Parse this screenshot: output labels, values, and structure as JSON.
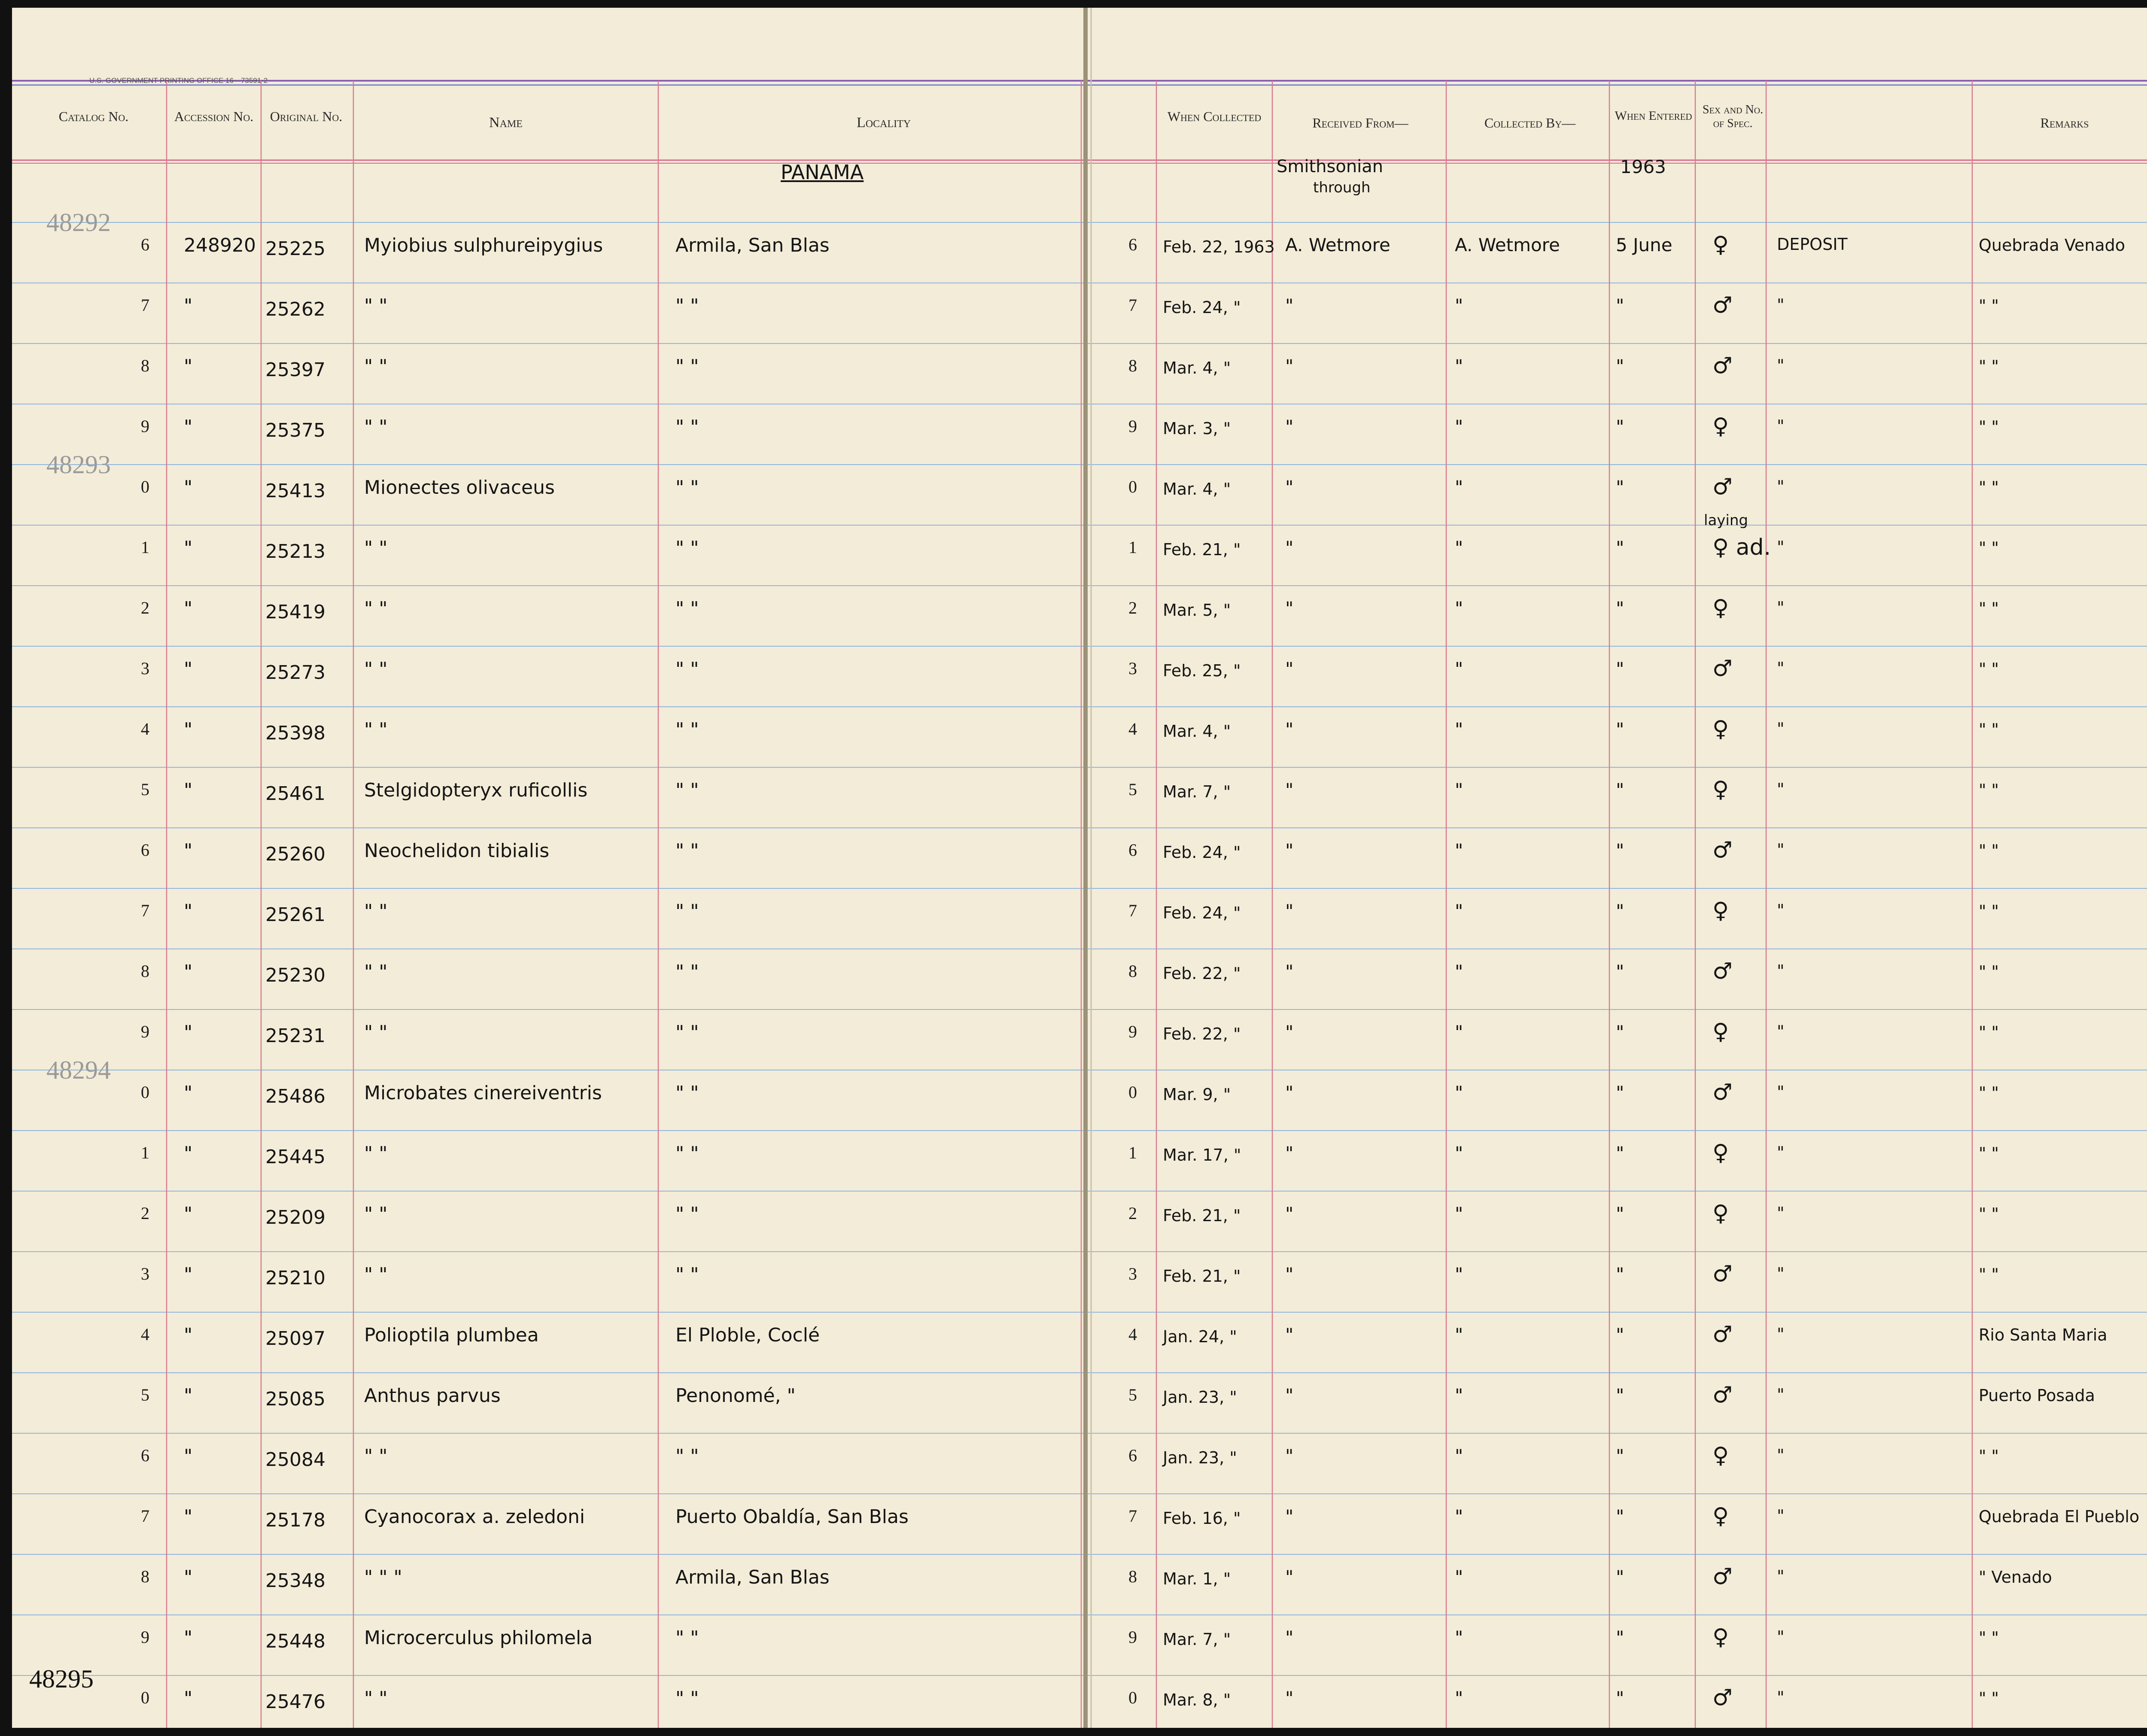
{
  "page": {
    "printer_note": "U.S. GOVERNMENT PRINTING OFFICE    16—73591-2"
  },
  "headers": {
    "catalog_no": "Catalog No.",
    "accession_no": "Accession No.",
    "original_no": "Original No.",
    "name": "Name",
    "locality": "Locality",
    "when_collected": "When Collected",
    "received_from": "Received From—",
    "collected_by": "Collected By—",
    "when_entered": "When Entered",
    "sex": "Sex and No. of Spec.",
    "remarks": "Remarks"
  },
  "top_notes": {
    "locality": "PANAMA",
    "received_from_1": "Smithsonian",
    "received_from_2": "through",
    "year": "1963"
  },
  "catalog_stamps": [
    {
      "text": "48292",
      "row": 0
    },
    {
      "text": "48293",
      "row": 4
    },
    {
      "text": "48294",
      "row": 14
    },
    {
      "text": "48295",
      "row": 24
    }
  ],
  "rows": [
    {
      "num": "6",
      "accession": "248920",
      "original": "25225",
      "name": "Myiobius sulphureipygius",
      "locality": "Armila,  San Blas",
      "num_r": "6",
      "collected": "Feb. 22, 1963",
      "received": "A. Wetmore",
      "collected_by": "A. Wetmore",
      "entered": "5 June",
      "sex": "♀",
      "deposit": "DEPOSIT",
      "remarks": "Quebrada Venado"
    },
    {
      "num": "7",
      "accession": "\"",
      "original": "25262",
      "name": "\"          \"",
      "locality": "\"          \"",
      "num_r": "7",
      "collected": "Feb. 24, \"",
      "received": "\"",
      "collected_by": "\"",
      "entered": "\"",
      "sex": "♂",
      "deposit": "\"",
      "remarks": "\"       \""
    },
    {
      "num": "8",
      "accession": "\"",
      "original": "25397",
      "name": "\"          \"",
      "locality": "\"          \"",
      "num_r": "8",
      "collected": "Mar. 4, \"",
      "received": "\"",
      "collected_by": "\"",
      "entered": "\"",
      "sex": "♂",
      "deposit": "\"",
      "remarks": "\"       \""
    },
    {
      "num": "9",
      "accession": "\"",
      "original": "25375",
      "name": "\"          \"",
      "locality": "\"          \"",
      "num_r": "9",
      "collected": "Mar. 3, \"",
      "received": "\"",
      "collected_by": "\"",
      "entered": "\"",
      "sex": "♀",
      "deposit": "\"",
      "remarks": "\"       \""
    },
    {
      "num": "0",
      "accession": "\"",
      "original": "25413",
      "name": "Mionectes  olivaceus",
      "locality": "\"          \"",
      "num_r": "0",
      "collected": "Mar. 4, \"",
      "received": "\"",
      "collected_by": "\"",
      "entered": "\"",
      "sex": "♂",
      "deposit": "\"",
      "remarks": "\"       \""
    },
    {
      "num": "1",
      "accession": "\"",
      "original": "25213",
      "name": "\"          \"",
      "locality": "\"          \"",
      "num_r": "1",
      "collected": "Feb. 21, \"",
      "received": "\"",
      "collected_by": "\"",
      "entered": "\"",
      "sex": "♀ ad.",
      "sex_note": "laying",
      "deposit": "\"",
      "remarks": "\"       \""
    },
    {
      "num": "2",
      "accession": "\"",
      "original": "25419",
      "name": "\"          \"",
      "locality": "\"          \"",
      "num_r": "2",
      "collected": "Mar. 5, \"",
      "received": "\"",
      "collected_by": "\"",
      "entered": "\"",
      "sex": "♀",
      "deposit": "\"",
      "remarks": "\"       \""
    },
    {
      "num": "3",
      "accession": "\"",
      "original": "25273",
      "name": "\"          \"",
      "locality": "\"          \"",
      "num_r": "3",
      "collected": "Feb. 25, \"",
      "received": "\"",
      "collected_by": "\"",
      "entered": "\"",
      "sex": "♂",
      "deposit": "\"",
      "remarks": "\"       \""
    },
    {
      "num": "4",
      "accession": "\"",
      "original": "25398",
      "name": "\"          \"",
      "locality": "\"          \"",
      "num_r": "4",
      "collected": "Mar. 4, \"",
      "received": "\"",
      "collected_by": "\"",
      "entered": "\"",
      "sex": "♀",
      "deposit": "\"",
      "remarks": "\"       \""
    },
    {
      "num": "5",
      "accession": "\"",
      "original": "25461",
      "name": "Stelgidopteryx  ruficollis",
      "locality": "\"          \"",
      "num_r": "5",
      "collected": "Mar. 7, \"",
      "received": "\"",
      "collected_by": "\"",
      "entered": "\"",
      "sex": "♀",
      "deposit": "\"",
      "remarks": "\"       \""
    },
    {
      "num": "6",
      "accession": "\"",
      "original": "25260",
      "name": "Neochelidon  tibialis",
      "locality": "\"          \"",
      "num_r": "6",
      "collected": "Feb. 24, \"",
      "received": "\"",
      "collected_by": "\"",
      "entered": "\"",
      "sex": "♂",
      "deposit": "\"",
      "remarks": "\"       \""
    },
    {
      "num": "7",
      "accession": "\"",
      "original": "25261",
      "name": "\"          \"",
      "locality": "\"          \"",
      "num_r": "7",
      "collected": "Feb. 24, \"",
      "received": "\"",
      "collected_by": "\"",
      "entered": "\"",
      "sex": "♀",
      "deposit": "\"",
      "remarks": "\"       \""
    },
    {
      "num": "8",
      "accession": "\"",
      "original": "25230",
      "name": "\"          \"",
      "locality": "\"          \"",
      "num_r": "8",
      "collected": "Feb. 22, \"",
      "received": "\"",
      "collected_by": "\"",
      "entered": "\"",
      "sex": "♂",
      "deposit": "\"",
      "remarks": "\"       \""
    },
    {
      "num": "9",
      "accession": "\"",
      "original": "25231",
      "name": "\"          \"",
      "locality": "\"          \"",
      "num_r": "9",
      "collected": "Feb. 22, \"",
      "received": "\"",
      "collected_by": "\"",
      "entered": "\"",
      "sex": "♀",
      "deposit": "\"",
      "remarks": "\"       \""
    },
    {
      "num": "0",
      "accession": "\"",
      "original": "25486",
      "name": "Microbates  cinereiventris",
      "locality": "\"          \"",
      "num_r": "0",
      "collected": "Mar. 9, \"",
      "received": "\"",
      "collected_by": "\"",
      "entered": "\"",
      "sex": "♂",
      "deposit": "\"",
      "remarks": "\"       \""
    },
    {
      "num": "1",
      "accession": "\"",
      "original": "25445",
      "name": "\"          \"",
      "locality": "\"          \"",
      "num_r": "1",
      "collected": "Mar. 17, \"",
      "received": "\"",
      "collected_by": "\"",
      "entered": "\"",
      "sex": "♀",
      "deposit": "\"",
      "remarks": "\"       \""
    },
    {
      "num": "2",
      "accession": "\"",
      "original": "25209",
      "name": "\"          \"",
      "locality": "\"          \"",
      "num_r": "2",
      "collected": "Feb. 21, \"",
      "received": "\"",
      "collected_by": "\"",
      "entered": "\"",
      "sex": "♀",
      "deposit": "\"",
      "remarks": "\"       \""
    },
    {
      "num": "3",
      "accession": "\"",
      "original": "25210",
      "name": "\"          \"",
      "locality": "\"          \"",
      "num_r": "3",
      "collected": "Feb. 21, \"",
      "received": "\"",
      "collected_by": "\"",
      "entered": "\"",
      "sex": "♂",
      "deposit": "\"",
      "remarks": "\"       \""
    },
    {
      "num": "4",
      "accession": "\"",
      "original": "25097",
      "name": "Polioptila  plumbea",
      "locality": "El Ploble,  Coclé",
      "num_r": "4",
      "collected": "Jan. 24, \"",
      "received": "\"",
      "collected_by": "\"",
      "entered": "\"",
      "sex": "♂",
      "deposit": "\"",
      "remarks": "Rio Santa Maria"
    },
    {
      "num": "5",
      "accession": "\"",
      "original": "25085",
      "name": "Anthus  parvus",
      "locality": "Penonomé,      \"",
      "num_r": "5",
      "collected": "Jan. 23, \"",
      "received": "\"",
      "collected_by": "\"",
      "entered": "\"",
      "sex": "♂",
      "deposit": "\"",
      "remarks": "Puerto  Posada"
    },
    {
      "num": "6",
      "accession": "\"",
      "original": "25084",
      "name": "\"      \"",
      "locality": "\"          \"",
      "num_r": "6",
      "collected": "Jan. 23, \"",
      "received": "\"",
      "collected_by": "\"",
      "entered": "\"",
      "sex": "♀",
      "deposit": "\"",
      "remarks": "\"       \""
    },
    {
      "num": "7",
      "accession": "\"",
      "original": "25178",
      "name": "Cyanocorax a. zeledoni",
      "locality": "Puerto Obaldía,  San Blas",
      "num_r": "7",
      "collected": "Feb. 16, \"",
      "received": "\"",
      "collected_by": "\"",
      "entered": "\"",
      "sex": "♀",
      "deposit": "\"",
      "remarks": "Quebrada El Pueblo"
    },
    {
      "num": "8",
      "accession": "\"",
      "original": "25348",
      "name": "\"     \"     \"",
      "locality": "Armila,  San Blas",
      "num_r": "8",
      "collected": "Mar. 1, \"",
      "received": "\"",
      "collected_by": "\"",
      "entered": "\"",
      "sex": "♂",
      "deposit": "\"",
      "remarks": "\"   Venado"
    },
    {
      "num": "9",
      "accession": "\"",
      "original": "25448",
      "name": "Microcerculus  philomela",
      "locality": "\"          \"",
      "num_r": "9",
      "collected": "Mar. 7, \"",
      "received": "\"",
      "collected_by": "\"",
      "entered": "\"",
      "sex": "♀",
      "deposit": "\"",
      "remarks": "\"       \""
    },
    {
      "num": "0",
      "accession": "\"",
      "original": "25476",
      "name": "\"          \"",
      "locality": "\"          \"",
      "num_r": "0",
      "collected": "Mar. 8, \"",
      "received": "\"",
      "collected_by": "\"",
      "entered": "\"",
      "sex": "♂",
      "deposit": "\"",
      "remarks": "\"       \""
    }
  ]
}
